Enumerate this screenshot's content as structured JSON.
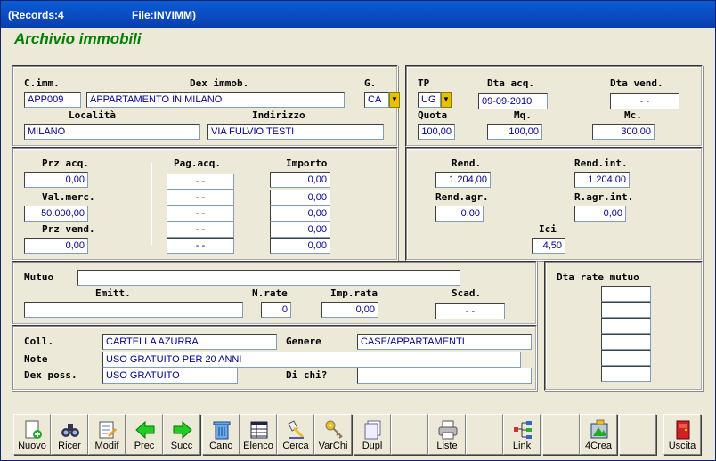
{
  "window": {
    "records": "(Records:4",
    "file": "File:INVIMM)"
  },
  "form": {
    "title": "Archivio immobili"
  },
  "id": {
    "cimm_label": "C.imm.",
    "cimm": "APP009",
    "dex_label": "Dex immob.",
    "dex": "APPARTAMENTO IN MILANO",
    "g_label": "G.",
    "g": "CA",
    "localita_label": "Località",
    "localita": "MILANO",
    "indirizzo_label": "Indirizzo",
    "indirizzo": "VIA FULVIO TESTI"
  },
  "acq": {
    "tp_label": "TP",
    "tp": "UG",
    "dta_acq_label": "Dta acq.",
    "dta_acq": "09-09-2010",
    "dta_vend_label": "Dta vend.",
    "dta_vend": "-  -",
    "quota_label": "Quota",
    "quota": "100,00",
    "mq_label": "Mq.",
    "mq": "100,00",
    "mc_label": "Mc.",
    "mc": "300,00"
  },
  "prezzi": {
    "prz_acq_label": "Prz acq.",
    "prz_acq": "0,00",
    "val_merc_label": "Val.merc.",
    "val_merc": "50.000,00",
    "prz_vend_label": "Prz vend.",
    "prz_vend": "0,00",
    "pag_label": "Pag.acq.",
    "importo_label": "Importo",
    "pag": [
      "-  -",
      "-  -",
      "-  -",
      "-  -",
      "-  -"
    ],
    "importi": [
      "0,00",
      "0,00",
      "0,00",
      "0,00",
      "0,00"
    ]
  },
  "rend": {
    "rend_label": "Rend.",
    "rend": "1.204,00",
    "rend_int_label": "Rend.int.",
    "rend_int": "1.204,00",
    "rend_agr_label": "Rend.agr.",
    "rend_agr": "0,00",
    "ragr_int_label": "R.agr.int.",
    "ragr_int": "0,00",
    "ici_label": "Ici",
    "ici": "4,50"
  },
  "mutuo": {
    "mutuo_label": "Mutuo",
    "mutuo": "",
    "emitt_label": "Emitt.",
    "emitt": "",
    "nrate_label": "N.rate",
    "nrate": "0",
    "imprata_label": "Imp.rata",
    "imprata": "0,00",
    "scad_label": "Scad.",
    "scad": "-  -",
    "rate_label": "Dta rate mutuo",
    "rate": [
      "",
      "",
      "",
      "",
      "",
      ""
    ]
  },
  "altro": {
    "coll_label": "Coll.",
    "coll": "CARTELLA AZURRA",
    "genere_label": "Genere",
    "genere": "CASE/APPARTAMENTI",
    "note_label": "Note",
    "note": "USO GRATUITO PER 20 ANNI",
    "dexposs_label": "Dex poss.",
    "dexposs": "USO GRATUITO",
    "dichi_label": "Di chi?",
    "dichi": ""
  },
  "toolbar": {
    "nuovo": "Nuovo",
    "ricer": "Ricer",
    "modif": "Modif",
    "prec": "Prec",
    "succ": "Succ",
    "canc": "Canc",
    "elenco": "Elenco",
    "cerca": "Cerca",
    "varchi": "VarChi",
    "dupl": "Dupl",
    "liste": "Liste",
    "link": "Link",
    "crea": "4Crea",
    "uscita": "Uscita"
  }
}
